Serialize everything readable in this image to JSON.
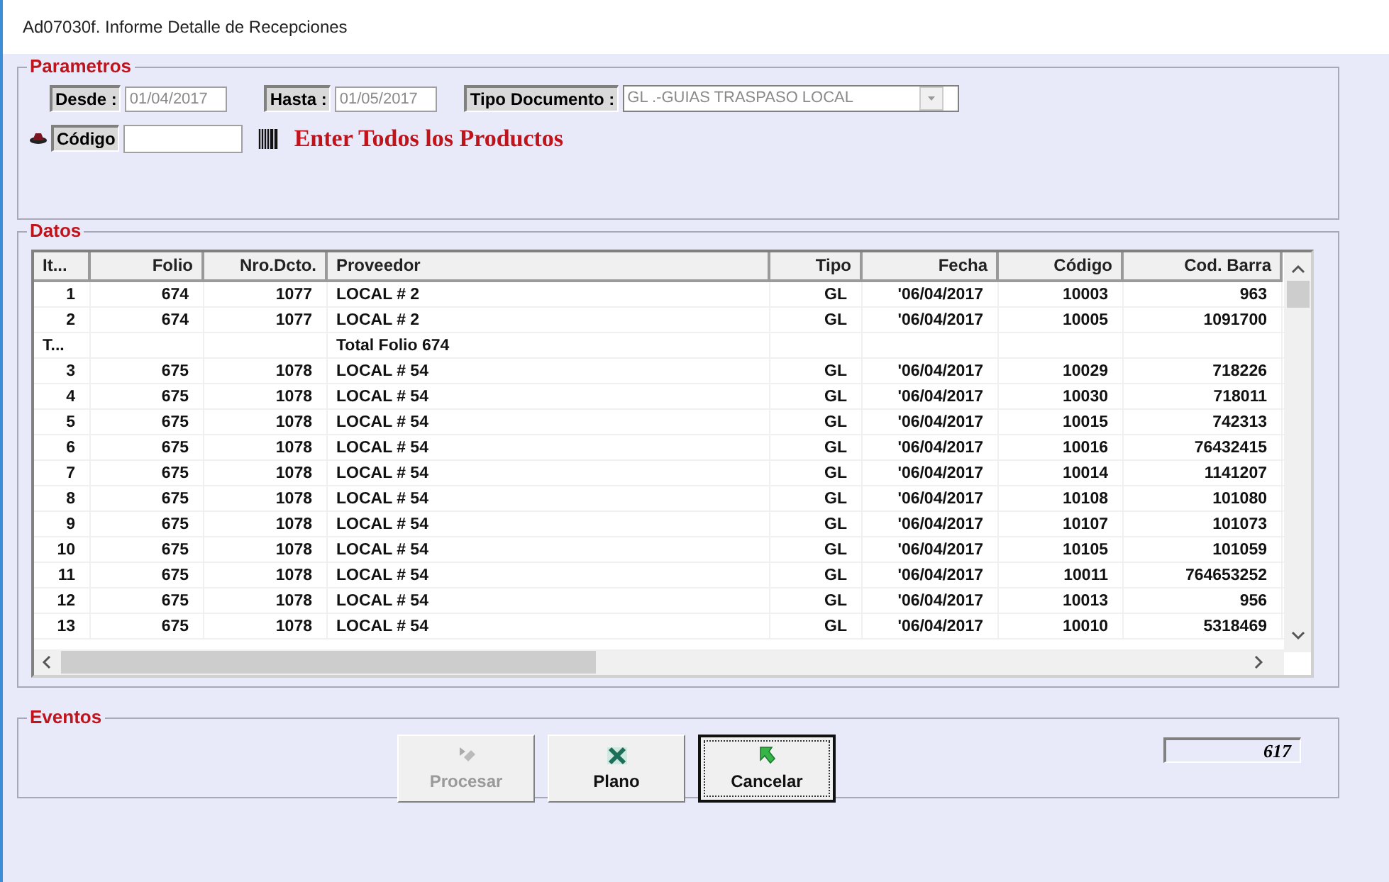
{
  "window": {
    "title": "Ad07030f. Informe Detalle de Recepciones"
  },
  "parametros": {
    "legend": "Parametros",
    "desde": {
      "label": "Desde :",
      "value": "01/04/2017"
    },
    "hasta": {
      "label": "Hasta :",
      "value": "01/05/2017"
    },
    "tipo_documento": {
      "label": "Tipo Documento :",
      "value": "GL .-GUIAS TRASPASO LOCAL"
    },
    "codigo": {
      "label": "Código"
    },
    "hint": "Enter Todos los Productos"
  },
  "datos": {
    "legend": "Datos",
    "table": {
      "columns": [
        {
          "label": "It..."
        },
        {
          "label": "Folio"
        },
        {
          "label": "Nro.Dcto."
        },
        {
          "label": "Proveedor"
        },
        {
          "label": "Tipo"
        },
        {
          "label": "Fecha"
        },
        {
          "label": "Código"
        },
        {
          "label": "Cod. Barra"
        }
      ],
      "rows": [
        {
          "kind": "item",
          "cells": [
            "1",
            "674",
            "1077",
            "LOCAL # 2",
            "GL",
            "'06/04/2017",
            "10003",
            "963"
          ]
        },
        {
          "kind": "item",
          "cells": [
            "2",
            "674",
            "1077",
            "LOCAL # 2",
            "GL",
            "'06/04/2017",
            "10005",
            "1091700"
          ]
        },
        {
          "kind": "total",
          "cells": [
            "T...",
            "",
            "",
            "Total Folio 674",
            "",
            "",
            "",
            ""
          ]
        },
        {
          "kind": "item",
          "cells": [
            "3",
            "675",
            "1078",
            "LOCAL # 54",
            "GL",
            "'06/04/2017",
            "10029",
            "718226"
          ]
        },
        {
          "kind": "item",
          "cells": [
            "4",
            "675",
            "1078",
            "LOCAL # 54",
            "GL",
            "'06/04/2017",
            "10030",
            "718011"
          ]
        },
        {
          "kind": "item",
          "cells": [
            "5",
            "675",
            "1078",
            "LOCAL # 54",
            "GL",
            "'06/04/2017",
            "10015",
            "742313"
          ]
        },
        {
          "kind": "item",
          "cells": [
            "6",
            "675",
            "1078",
            "LOCAL # 54",
            "GL",
            "'06/04/2017",
            "10016",
            "76432415"
          ]
        },
        {
          "kind": "item",
          "cells": [
            "7",
            "675",
            "1078",
            "LOCAL # 54",
            "GL",
            "'06/04/2017",
            "10014",
            "1141207"
          ]
        },
        {
          "kind": "item",
          "cells": [
            "8",
            "675",
            "1078",
            "LOCAL # 54",
            "GL",
            "'06/04/2017",
            "10108",
            "101080"
          ]
        },
        {
          "kind": "item",
          "cells": [
            "9",
            "675",
            "1078",
            "LOCAL # 54",
            "GL",
            "'06/04/2017",
            "10107",
            "101073"
          ]
        },
        {
          "kind": "item",
          "cells": [
            "10",
            "675",
            "1078",
            "LOCAL # 54",
            "GL",
            "'06/04/2017",
            "10105",
            "101059"
          ]
        },
        {
          "kind": "item",
          "cells": [
            "11",
            "675",
            "1078",
            "LOCAL # 54",
            "GL",
            "'06/04/2017",
            "10011",
            "764653252"
          ]
        },
        {
          "kind": "item",
          "cells": [
            "12",
            "675",
            "1078",
            "LOCAL # 54",
            "GL",
            "'06/04/2017",
            "10013",
            "956"
          ]
        },
        {
          "kind": "item",
          "cells": [
            "13",
            "675",
            "1078",
            "LOCAL # 54",
            "GL",
            "'06/04/2017",
            "10010",
            "5318469"
          ]
        }
      ]
    }
  },
  "eventos": {
    "legend": "Eventos",
    "buttons": [
      {
        "kind": "procesar",
        "label": "Procesar",
        "disabled": true,
        "focused": false
      },
      {
        "kind": "plano",
        "label": "Plano",
        "disabled": false,
        "focused": false
      },
      {
        "kind": "cancelar",
        "label": "Cancelar",
        "disabled": false,
        "focused": true
      }
    ],
    "counter": "617"
  }
}
